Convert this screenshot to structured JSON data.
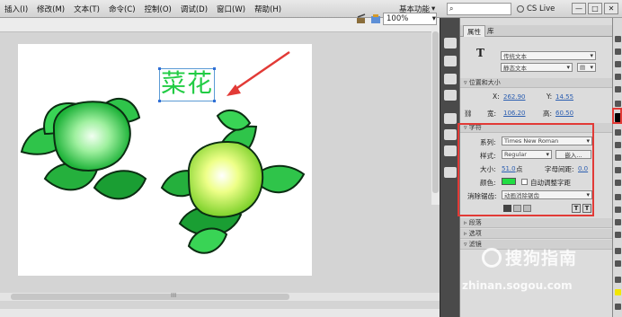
{
  "menubar": {
    "items": [
      "插入(I)",
      "修改(M)",
      "文本(T)",
      "命令(C)",
      "控制(O)",
      "调试(D)",
      "窗口(W)",
      "帮助(H)"
    ],
    "workspace": "基本功能",
    "search_placeholder": "",
    "cs_live": "CS Live",
    "window_buttons": [
      "—",
      "□",
      "✕"
    ]
  },
  "stage": {
    "zoom": "100%",
    "text_content": "菜花",
    "scroll_marker": "III"
  },
  "properties_panel": {
    "tabs": [
      "属性",
      "库"
    ],
    "text_tool_icon": "T",
    "text_type": "传统文本",
    "text_mode": "静态文本",
    "position_size_header": "位置和大小",
    "x_label": "X:",
    "x_value": "262.90",
    "y_label": "Y:",
    "y_value": "14.55",
    "width_label": "宽:",
    "width_value": "106.20",
    "height_label": "高:",
    "height_value": "60.50",
    "character_header": "字符",
    "family_label": "系列:",
    "family_value": "Times New Roman",
    "style_label": "样式:",
    "style_value": "Regular",
    "embed_button": "嵌入...",
    "size_label": "大小:",
    "size_value": "51.0",
    "size_unit": "点",
    "spacing_label": "字母间距:",
    "spacing_value": "0.0",
    "color_label": "颜色:",
    "color_swatch": "#22dd44",
    "auto_kern_label": "自动调整字距",
    "antialias_label": "消除锯齿:",
    "antialias_value": "动画消除锯齿",
    "paragraph_header": "段落",
    "options_header": "选项",
    "filters_header": "滤镜"
  },
  "watermark": {
    "brand": "搜狗指南",
    "url": "zhinan.sogou.com"
  },
  "colors": {
    "accent_red": "#e23a36",
    "text_green": "#22cc44",
    "link_blue": "#2a5db0"
  }
}
